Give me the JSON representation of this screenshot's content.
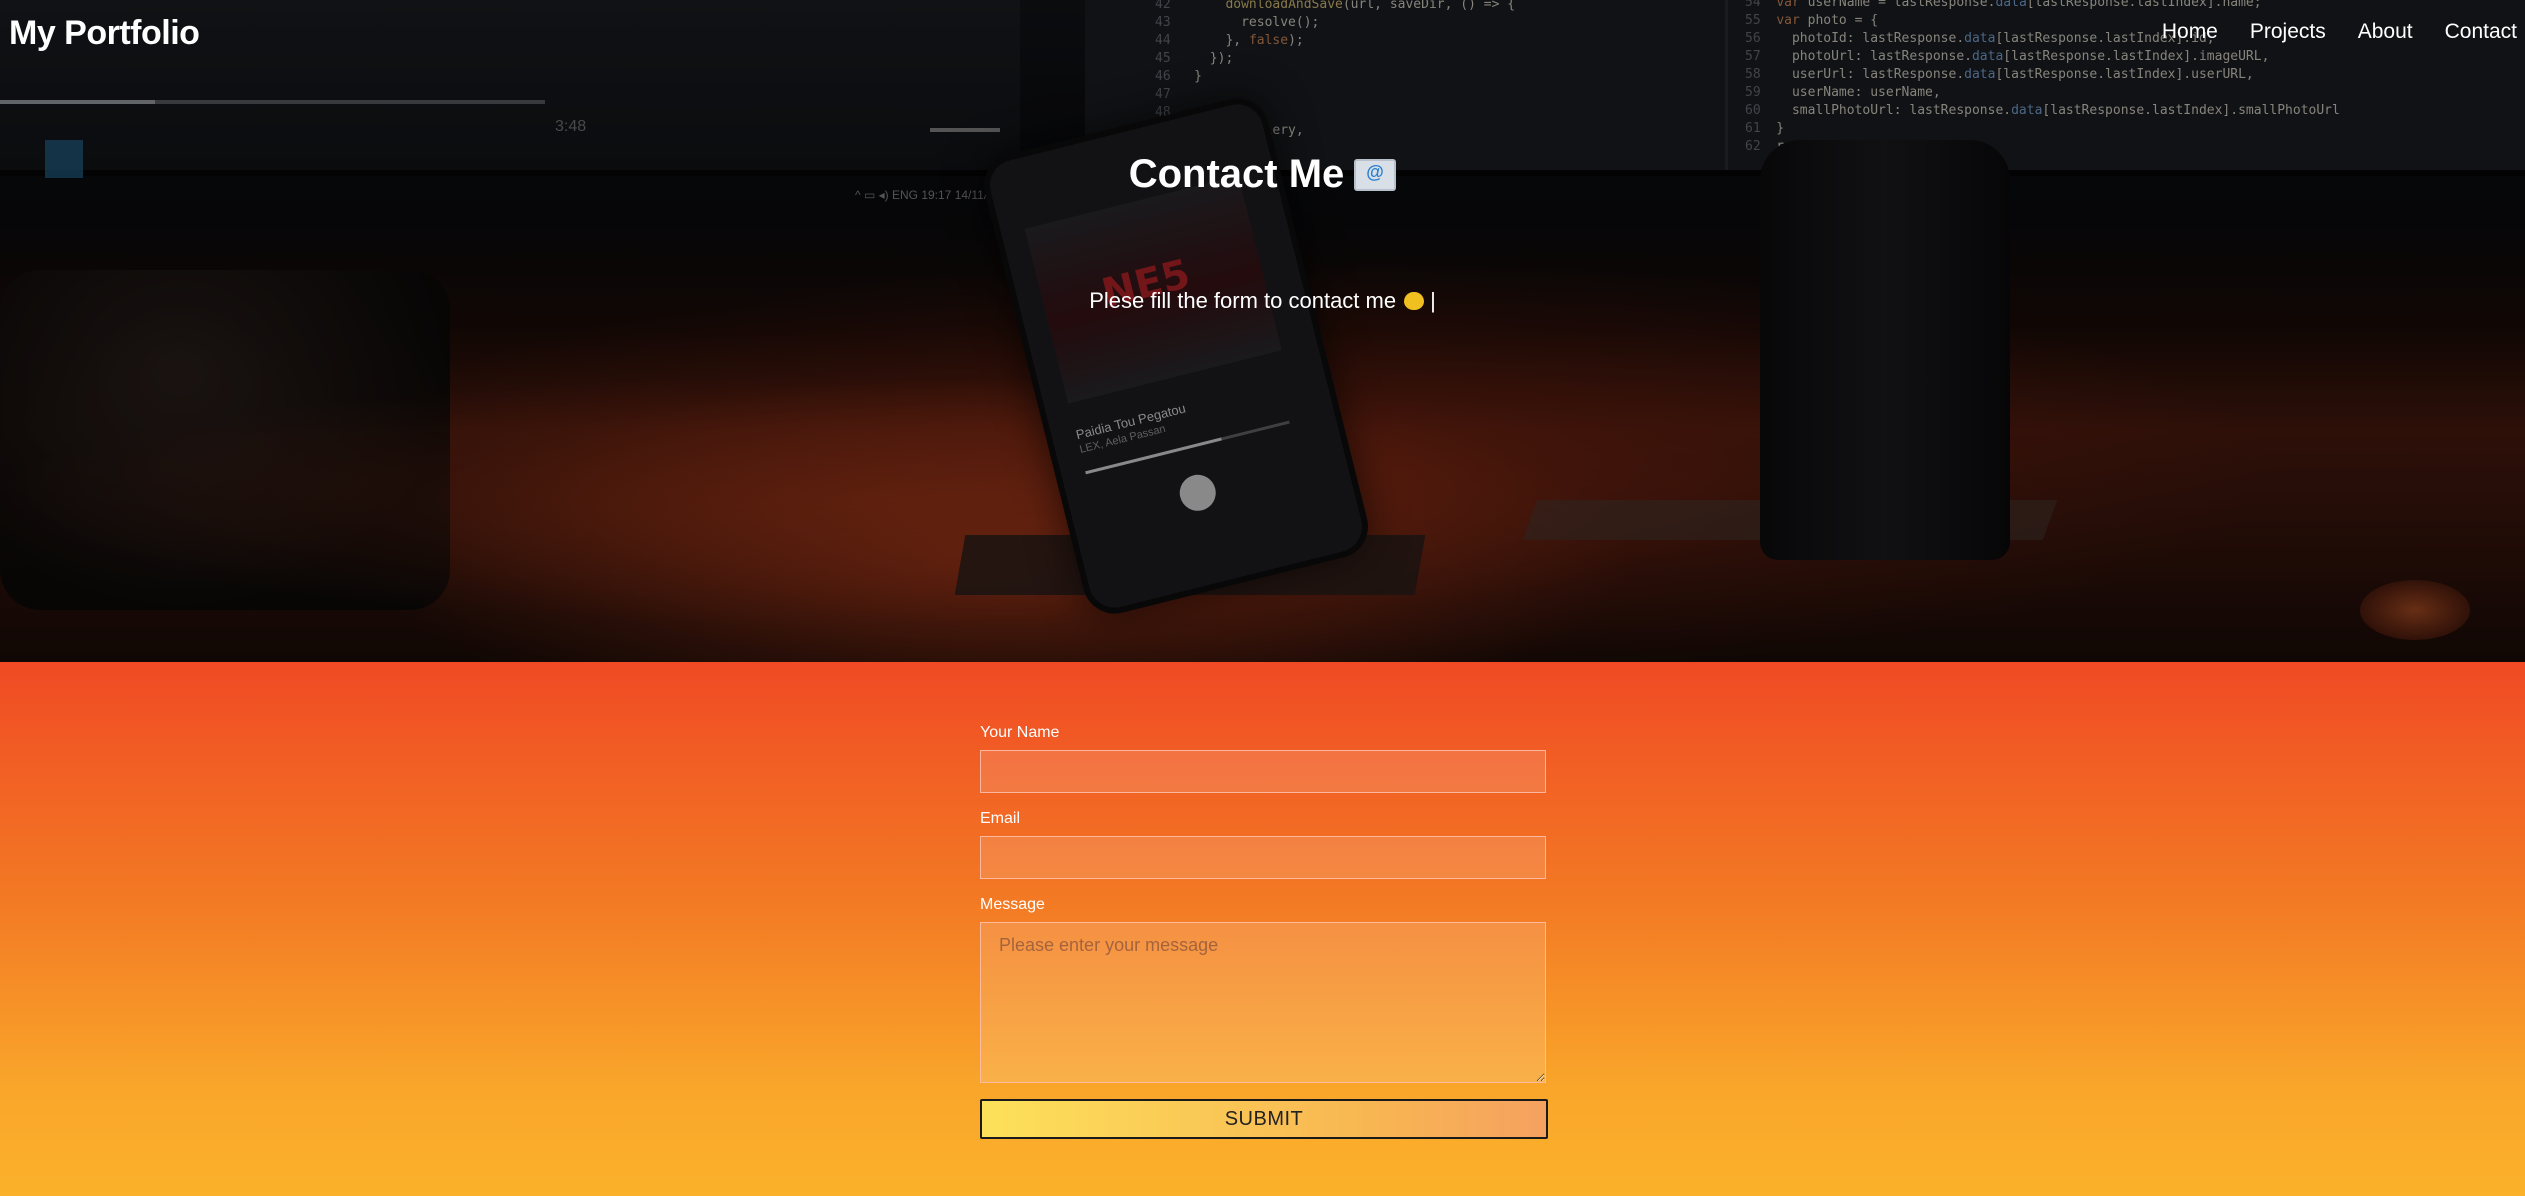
{
  "nav": {
    "brand": "My Portfolio",
    "links": [
      "Home",
      "Projects",
      "About",
      "Contact"
    ]
  },
  "hero": {
    "title": "Contact Me",
    "title_icon": "email-icon",
    "subtitle": "Plese fill the form to contact me",
    "subtitle_icon": "yellow-heart-icon",
    "cursor": "|"
  },
  "form": {
    "name_label": "Your Name",
    "name_value": "",
    "email_label": "Email",
    "email_value": "",
    "message_label": "Message",
    "message_placeholder": "Please enter your message",
    "submit_label": "SUBMIT"
  },
  "colors": {
    "form_gradient_top": "#f04a24",
    "form_gradient_bottom": "#fbb12a",
    "submit_gradient_left": "#fde15a",
    "submit_gradient_right": "#f5a160"
  }
}
